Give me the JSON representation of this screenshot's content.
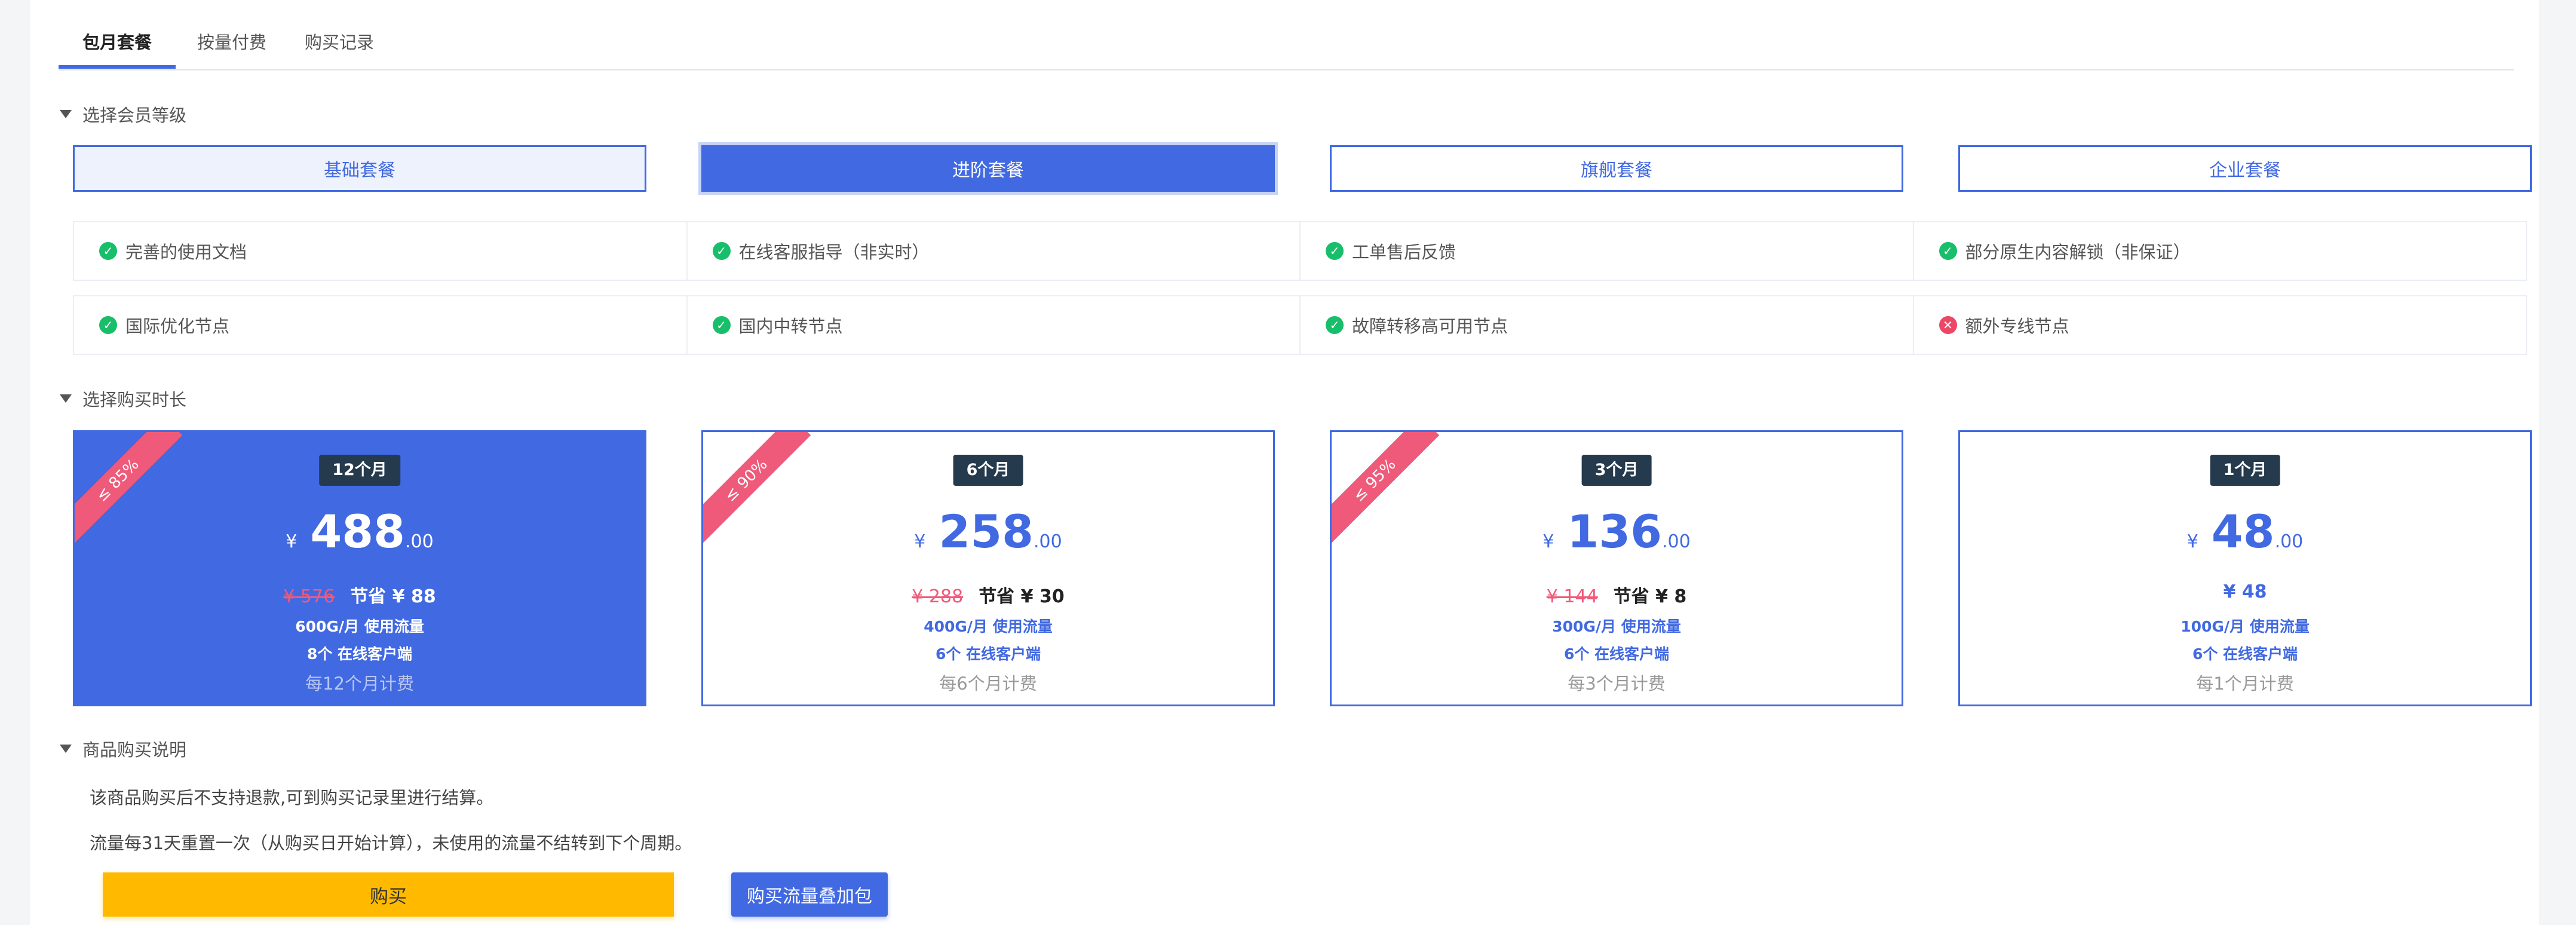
{
  "tabs": [
    {
      "label": "包月套餐",
      "active": true
    },
    {
      "label": "按量付费",
      "active": false
    },
    {
      "label": "购买记录",
      "active": false
    }
  ],
  "sections": {
    "level_title": "选择会员等级",
    "duration_title": "选择购买时长",
    "notes_title": "商品购买说明"
  },
  "levels": [
    {
      "label": "基础套餐"
    },
    {
      "label": "进阶套餐",
      "active": true
    },
    {
      "label": "旗舰套餐"
    },
    {
      "label": "企业套餐"
    }
  ],
  "features": [
    {
      "label": "完善的使用文档",
      "included": true,
      "icon": "check-circle-icon"
    },
    {
      "label": "在线客服指导（非实时）",
      "included": true,
      "icon": "check-circle-icon"
    },
    {
      "label": "工单售后反馈",
      "included": true,
      "icon": "check-circle-icon"
    },
    {
      "label": "部分原生内容解锁（非保证）",
      "included": true,
      "icon": "check-circle-icon"
    },
    {
      "label": "国际优化节点",
      "included": true,
      "icon": "check-circle-icon"
    },
    {
      "label": "国内中转节点",
      "included": true,
      "icon": "check-circle-icon"
    },
    {
      "label": "故障转移高可用节点",
      "included": true,
      "icon": "check-circle-icon"
    },
    {
      "label": "额外专线节点",
      "included": false,
      "icon": "x-circle-icon"
    }
  ],
  "durations": [
    {
      "ribbon": "≤ 85%",
      "badge": "12个月",
      "currency": "¥",
      "price": "488",
      "cents": ".00",
      "old_price": "¥ 576",
      "save": "节省 ¥ 88",
      "traffic": "600G/月 使用流量",
      "clients": "8个 在线客户端",
      "billing": "每12个月计费",
      "active": true
    },
    {
      "ribbon": "≤ 90%",
      "badge": "6个月",
      "currency": "¥",
      "price": "258",
      "cents": ".00",
      "old_price": "¥ 288",
      "save": "节省 ¥ 30",
      "traffic": "400G/月 使用流量",
      "clients": "6个 在线客户端",
      "billing": "每6个月计费"
    },
    {
      "ribbon": "≤ 95%",
      "badge": "3个月",
      "currency": "¥",
      "price": "136",
      "cents": ".00",
      "old_price": "¥ 144",
      "save": "节省 ¥ 8",
      "traffic": "300G/月 使用流量",
      "clients": "6个 在线客户端",
      "billing": "每3个月计费"
    },
    {
      "badge": "1个月",
      "currency": "¥",
      "price": "48",
      "cents": ".00",
      "only_price": "¥ 48",
      "traffic": "100G/月 使用流量",
      "clients": "6个 在线客户端",
      "billing": "每1个月计费"
    }
  ],
  "notes": [
    "该商品购买后不支持退款,可到购买记录里进行结算。",
    "流量每31天重置一次（从购买日开始计算），未使用的流量不结转到下个周期。"
  ],
  "actions": {
    "buy_label": "购买",
    "addon_label": "购买流量叠加包"
  },
  "colors": {
    "primary": "#4169e1",
    "buy": "#ffba00",
    "ribbon": "#ef5a7a",
    "success": "#19be6b",
    "danger": "#ed4766",
    "badge": "#263a4d"
  }
}
